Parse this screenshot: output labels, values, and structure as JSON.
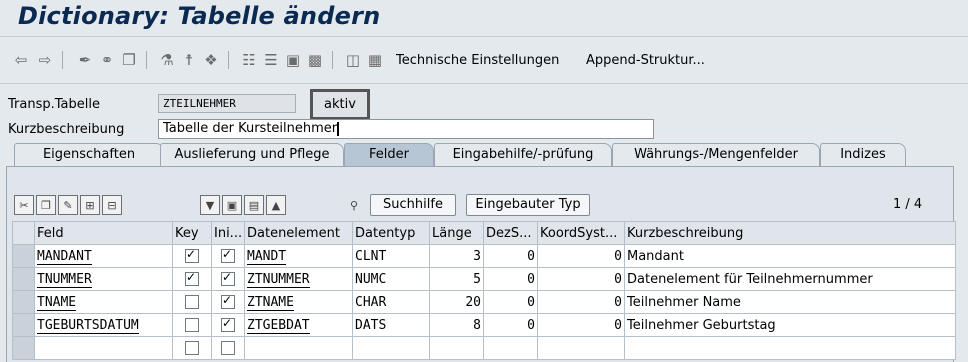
{
  "window": {
    "title": "Dictionary: Tabelle ändern"
  },
  "toolbar": {
    "back_icon": "arrow-left-icon",
    "forward_icon": "arrow-right-icon",
    "technische_einstellungen": "Technische Einstellungen",
    "append_struktur": "Append-Struktur..."
  },
  "header_form": {
    "table_label": "Transp.Tabelle",
    "table_value": "ZTEILNEHMER",
    "status": "aktiv",
    "desc_label": "Kurzbeschreibung",
    "desc_value": "Tabelle der Kursteilnehmer"
  },
  "tabs": [
    {
      "label": "Eigenschaften",
      "active": false
    },
    {
      "label": "Auslieferung und Pflege",
      "active": false
    },
    {
      "label": "Felder",
      "active": true
    },
    {
      "label": "Eingabehilfe/-prüfung",
      "active": false
    },
    {
      "label": "Währungs-/Mengenfelder",
      "active": false
    },
    {
      "label": "Indizes",
      "active": false
    }
  ],
  "table_toolbar": {
    "suchhilfe": "Suchhilfe",
    "eingebauter_typ": "Eingebauter Typ",
    "page_count": "1 / 4"
  },
  "grid": {
    "columns": [
      "Feld",
      "Key",
      "Ini...",
      "Datenelement",
      "Datentyp",
      "Länge",
      "DezS...",
      "KoordSyst...",
      "Kurzbeschreibung"
    ],
    "rows": [
      {
        "feld": "MANDANT",
        "key": true,
        "ini": true,
        "datenelement": "MANDT",
        "datentyp": "CLNT",
        "laenge": "3",
        "dez": "0",
        "koord": "0",
        "kurz": "Mandant"
      },
      {
        "feld": "TNUMMER",
        "key": true,
        "ini": true,
        "datenelement": "ZTNUMMER",
        "datentyp": "NUMC",
        "laenge": "5",
        "dez": "0",
        "koord": "0",
        "kurz": "Datenelement für Teilnehmernummer"
      },
      {
        "feld": "TNAME",
        "key": false,
        "ini": true,
        "datenelement": "ZTNAME",
        "datentyp": "CHAR",
        "laenge": "20",
        "dez": "0",
        "koord": "0",
        "kurz": "Teilnehmer Name"
      },
      {
        "feld": "TGEBURTSDATUM",
        "key": false,
        "ini": true,
        "datenelement": "ZTGEBDAT",
        "datentyp": "DATS",
        "laenge": "8",
        "dez": "0",
        "koord": "0",
        "kurz": "Teilnehmer Geburtstag"
      },
      {
        "feld": "",
        "key": false,
        "ini": false,
        "datenelement": "",
        "datentyp": "",
        "laenge": "",
        "dez": "",
        "koord": "",
        "kurz": ""
      }
    ]
  }
}
